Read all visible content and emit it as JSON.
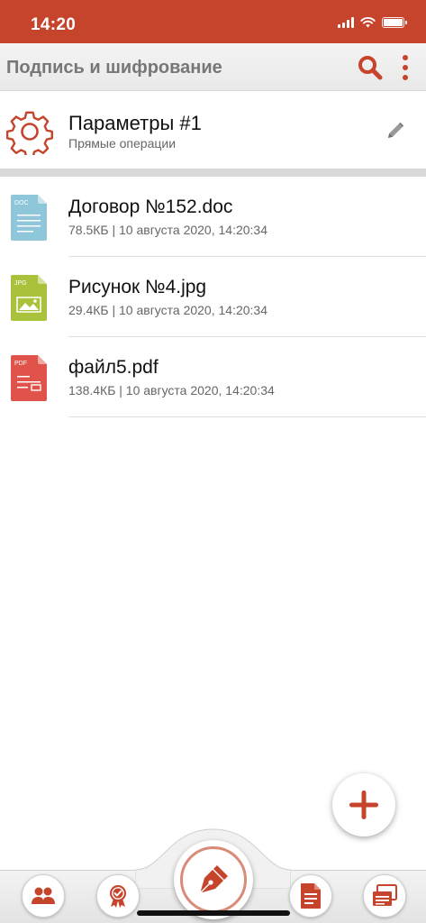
{
  "status_bar": {
    "time": "14:20"
  },
  "app_bar": {
    "title": "Подпись и шифрование"
  },
  "profile": {
    "title": "Параметры #1",
    "subtitle": "Прямые операции"
  },
  "files": [
    {
      "name": "Договор №152.doc",
      "meta": "78.5КБ | 10 августа 2020, 14:20:34",
      "type_label": "DOC",
      "color": "#8ec6da"
    },
    {
      "name": "Рисунок №4.jpg",
      "meta": "29.4КБ | 10 августа 2020, 14:20:34",
      "type_label": "JPG",
      "color": "#a9c23c"
    },
    {
      "name": "файл5.pdf",
      "meta": "138.4КБ | 10 августа 2020, 14:20:34",
      "type_label": "PDF",
      "color": "#e0534a"
    }
  ],
  "icons": {
    "search": "search-icon",
    "menu": "more-vertical-icon",
    "settings": "gear-icon",
    "edit": "pencil-icon",
    "add": "plus-icon",
    "contacts": "people-icon",
    "certificates": "certificate-icon",
    "sign": "fountain-pen-icon",
    "documents": "document-icon",
    "windows": "windows-stack-icon"
  },
  "colors": {
    "accent": "#c5442b",
    "app_bar_title": "#777777"
  }
}
